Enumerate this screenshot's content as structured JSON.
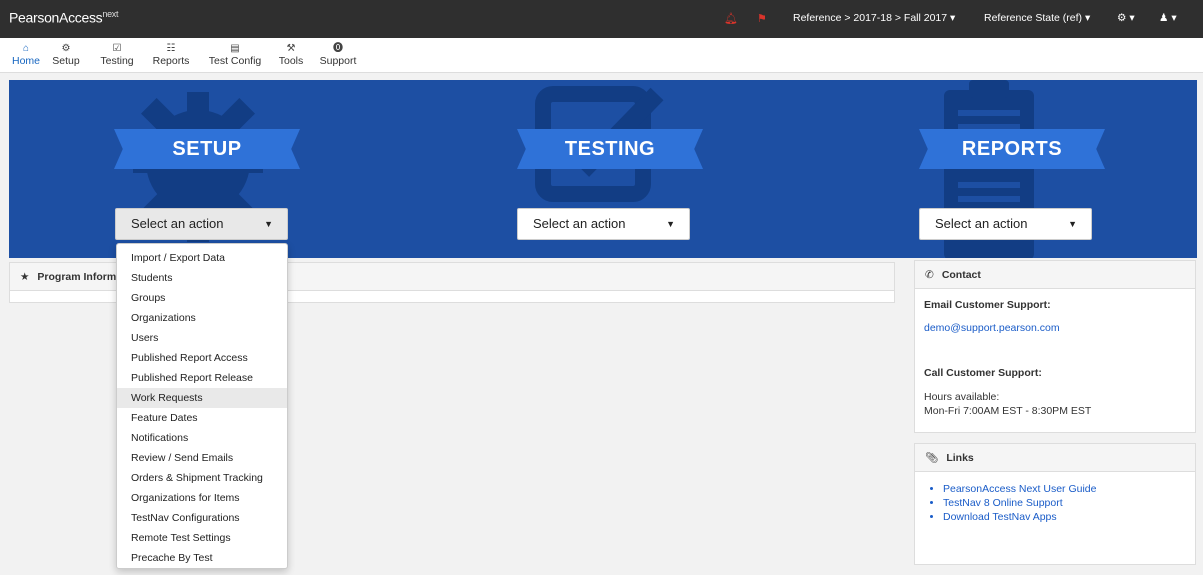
{
  "topbar": {
    "brand": "PearsonAccess",
    "brand_sup": "next",
    "bell_icon": "bell-icon",
    "flag_icon": "flag-icon",
    "context": "Reference > 2017-18 > Fall 2017 ▾",
    "org": "Reference State (ref) ▾",
    "settings": "⚙ ▾",
    "user": "♟ ▾"
  },
  "nav": {
    "items": [
      {
        "label": "Home",
        "icon": "⌂"
      },
      {
        "label": "Setup",
        "icon": "⚙"
      },
      {
        "label": "Testing",
        "icon": "☑"
      },
      {
        "label": "Reports",
        "icon": "☷"
      },
      {
        "label": "Test Config",
        "icon": "▤"
      },
      {
        "label": "Tools",
        "icon": "⚒"
      },
      {
        "label": "Support",
        "icon": "⓿"
      }
    ]
  },
  "hero": {
    "setup_title": "SETUP",
    "testing_title": "TESTING",
    "reports_title": "REPORTS",
    "select_label": "Select an action"
  },
  "setup_menu": [
    "Import / Export Data",
    "Students",
    "Groups",
    "Organizations",
    "Users",
    "Published Report Access",
    "Published Report Release",
    "Work Requests",
    "Feature Dates",
    "Notifications",
    "Review / Send Emails",
    "Orders & Shipment Tracking",
    "Organizations for Items",
    "TestNav Configurations",
    "Remote Test Settings",
    "Precache By Test"
  ],
  "program_info": {
    "title": "Program Inform"
  },
  "contact": {
    "title": "Contact",
    "email_heading": "Email Customer Support:",
    "email": "demo@support.pearson.com",
    "call_heading": "Call Customer Support:",
    "hours_label": "Hours available:",
    "hours": "Mon-Fri 7:00AM EST - 8:30PM EST"
  },
  "links": {
    "title": "Links",
    "items": [
      "PearsonAccess Next User Guide",
      "TestNav 8 Online Support",
      "Download TestNav Apps"
    ]
  },
  "colors": {
    "hero": "#1d4fa3",
    "ribbon": "#2f72d8",
    "topbar": "#2f2f2f",
    "link": "#1a5cc8",
    "alert": "#d9342b"
  }
}
